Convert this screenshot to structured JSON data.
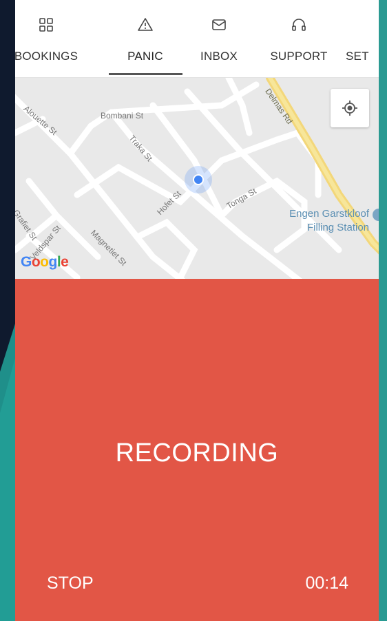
{
  "tabs": [
    {
      "label": "BOOKINGS",
      "icon": "grid-icon"
    },
    {
      "label": "PANIC",
      "icon": "warning-icon"
    },
    {
      "label": "INBOX",
      "icon": "mail-icon"
    },
    {
      "label": "SUPPORT",
      "icon": "headphones-icon"
    },
    {
      "label": "SET",
      "icon": "settings-icon"
    }
  ],
  "active_tab": "PANIC",
  "map": {
    "streets": {
      "alouette": "Alouette St",
      "bombani": "Bombani St",
      "delmas": "Delmas Rd",
      "traka": "Traka St",
      "hofet": "Hofet St",
      "tonga": "Tonga St",
      "grafiet": "Grafiet St",
      "veldspar": "Veldspar St",
      "magnetiet": "Magnetiet St"
    },
    "poi": {
      "line1": "Engen Garstkloof",
      "line2": "Filling Station"
    },
    "attribution": "Google",
    "colors": {
      "road_major": "#f5e07a",
      "background": "#e9e9e9",
      "location": "#4285f4"
    }
  },
  "recording": {
    "title": "RECORDING",
    "stop_label": "STOP",
    "elapsed": "00:14",
    "background": "#e25646"
  }
}
